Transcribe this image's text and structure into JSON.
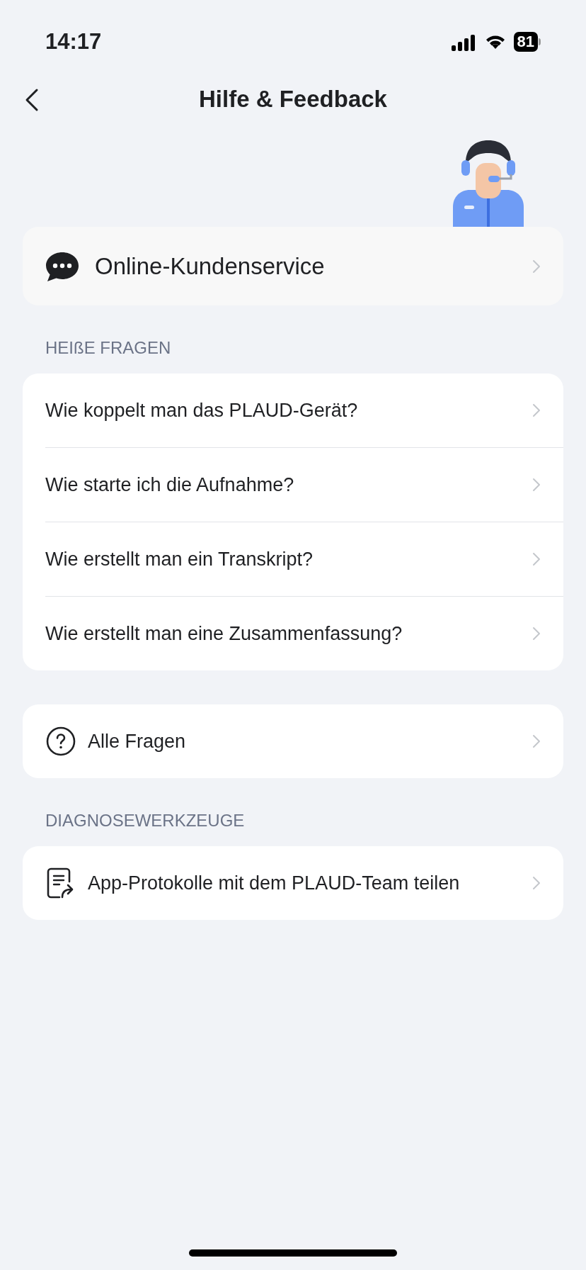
{
  "status_bar": {
    "time": "14:17",
    "battery": "81"
  },
  "header": {
    "title": "Hilfe & Feedback"
  },
  "service": {
    "label": "Online-Kundenservice"
  },
  "sections": [
    {
      "heading": "HEIßE FRAGEN",
      "items": [
        {
          "label": "Wie koppelt man das PLAUD-Gerät?"
        },
        {
          "label": "Wie starte ich die Aufnahme?"
        },
        {
          "label": "Wie erstellt man ein Transkript?"
        },
        {
          "label": "Wie erstellt man eine Zusammenfassung?"
        }
      ]
    },
    {
      "items": [
        {
          "label": "Alle Fragen",
          "kind": "question"
        }
      ]
    },
    {
      "heading": "DIAGNOSEWERKZEUGE",
      "items": [
        {
          "label": "App-Protokolle mit dem PLAUD-Team teilen",
          "kind": "share-doc"
        }
      ]
    }
  ]
}
